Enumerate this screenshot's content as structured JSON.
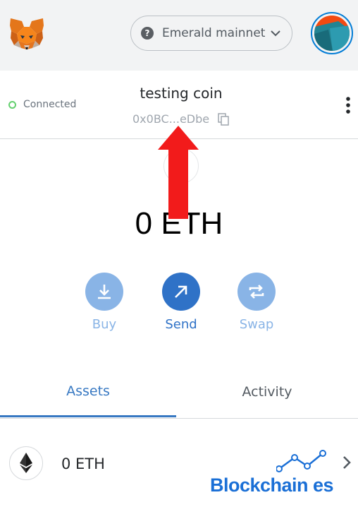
{
  "header": {
    "network_label": "Emerald mainnet",
    "network_icon_glyph": "?"
  },
  "account": {
    "connection_status": "Connected",
    "name": "testing coin",
    "address_short": "0x0BC...eDbe"
  },
  "balance": {
    "amount": "0 ETH"
  },
  "actions": {
    "buy_label": "Buy",
    "send_label": "Send",
    "swap_label": "Swap"
  },
  "tabs": {
    "assets_label": "Assets",
    "activity_label": "Activity",
    "active": "Assets"
  },
  "assets": [
    {
      "amount": "0 ETH",
      "icon": "ethereum-icon"
    }
  ],
  "watermark": {
    "text": "Blockchain es"
  },
  "colors": {
    "accent": "#2f72c7",
    "accent_light": "#89b4e6",
    "connected": "#64d06f",
    "annotation_arrow": "#f21b1b",
    "watermark": "#1a6fd6"
  }
}
